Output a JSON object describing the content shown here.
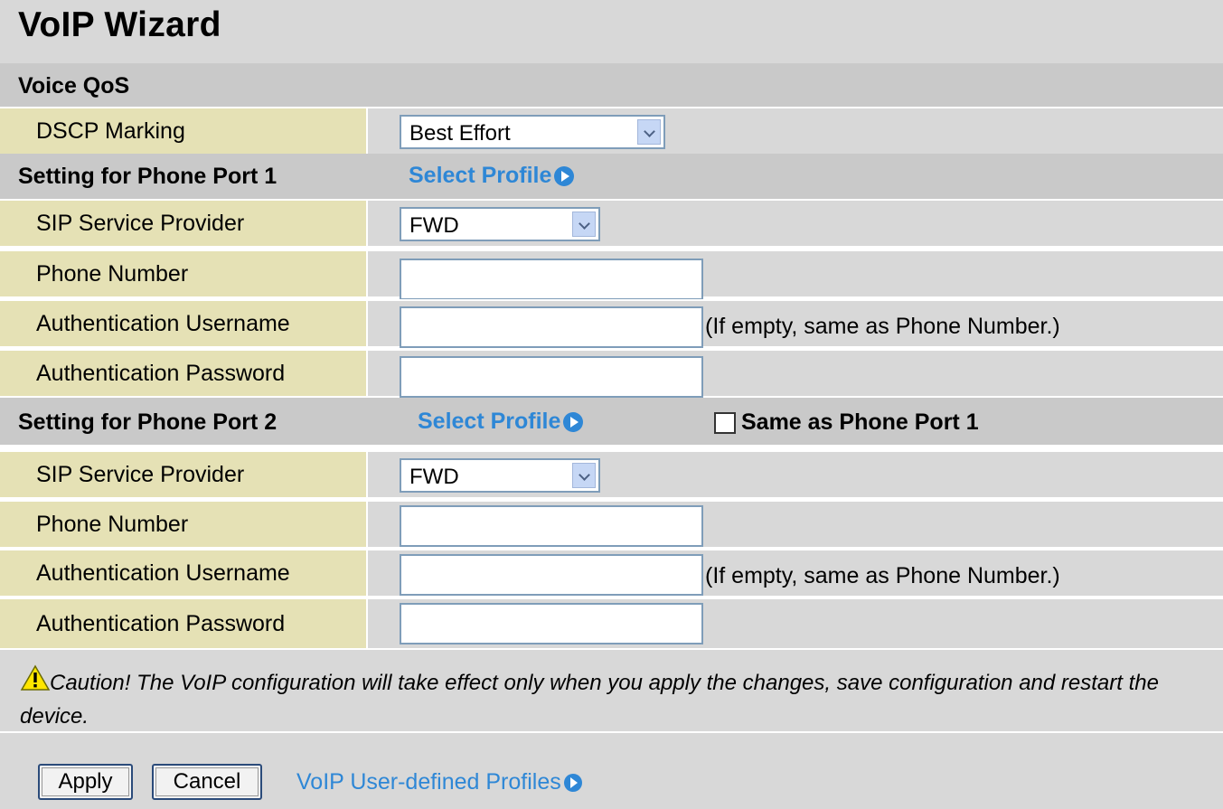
{
  "title": "VoIP Wizard",
  "voice_qos": {
    "heading": "Voice QoS",
    "dscp_label": "DSCP Marking",
    "dscp_value": "Best Effort"
  },
  "port1": {
    "heading": "Setting for Phone Port 1",
    "select_profile": "Select Profile",
    "sip_label": "SIP Service Provider",
    "sip_value": "FWD",
    "phone_label": "Phone Number",
    "phone_value": "",
    "username_label": "Authentication Username",
    "username_value": "",
    "username_hint": "(If empty, same as Phone Number.)",
    "password_label": "Authentication Password",
    "password_value": ""
  },
  "port2": {
    "heading": "Setting for Phone Port 2",
    "select_profile": "Select Profile",
    "same_as_label": "Same as Phone Port 1",
    "same_as_checked": false,
    "sip_label": "SIP Service Provider",
    "sip_value": "FWD",
    "phone_label": "Phone Number",
    "phone_value": "",
    "username_label": "Authentication Username",
    "username_value": "",
    "username_hint": "(If empty, same as Phone Number.)",
    "password_label": "Authentication Password",
    "password_value": ""
  },
  "caution_text": "Caution! The VoIP configuration will take effect only when you apply the changes, save configuration and restart the device.",
  "buttons": {
    "apply": "Apply",
    "cancel": "Cancel"
  },
  "user_profiles_link": "VoIP User-defined Profiles",
  "colors": {
    "link": "#2e87d6",
    "label_bg": "#e5e1b5",
    "section_bg": "#c9c9c9",
    "row_bg": "#d8d8d8"
  }
}
